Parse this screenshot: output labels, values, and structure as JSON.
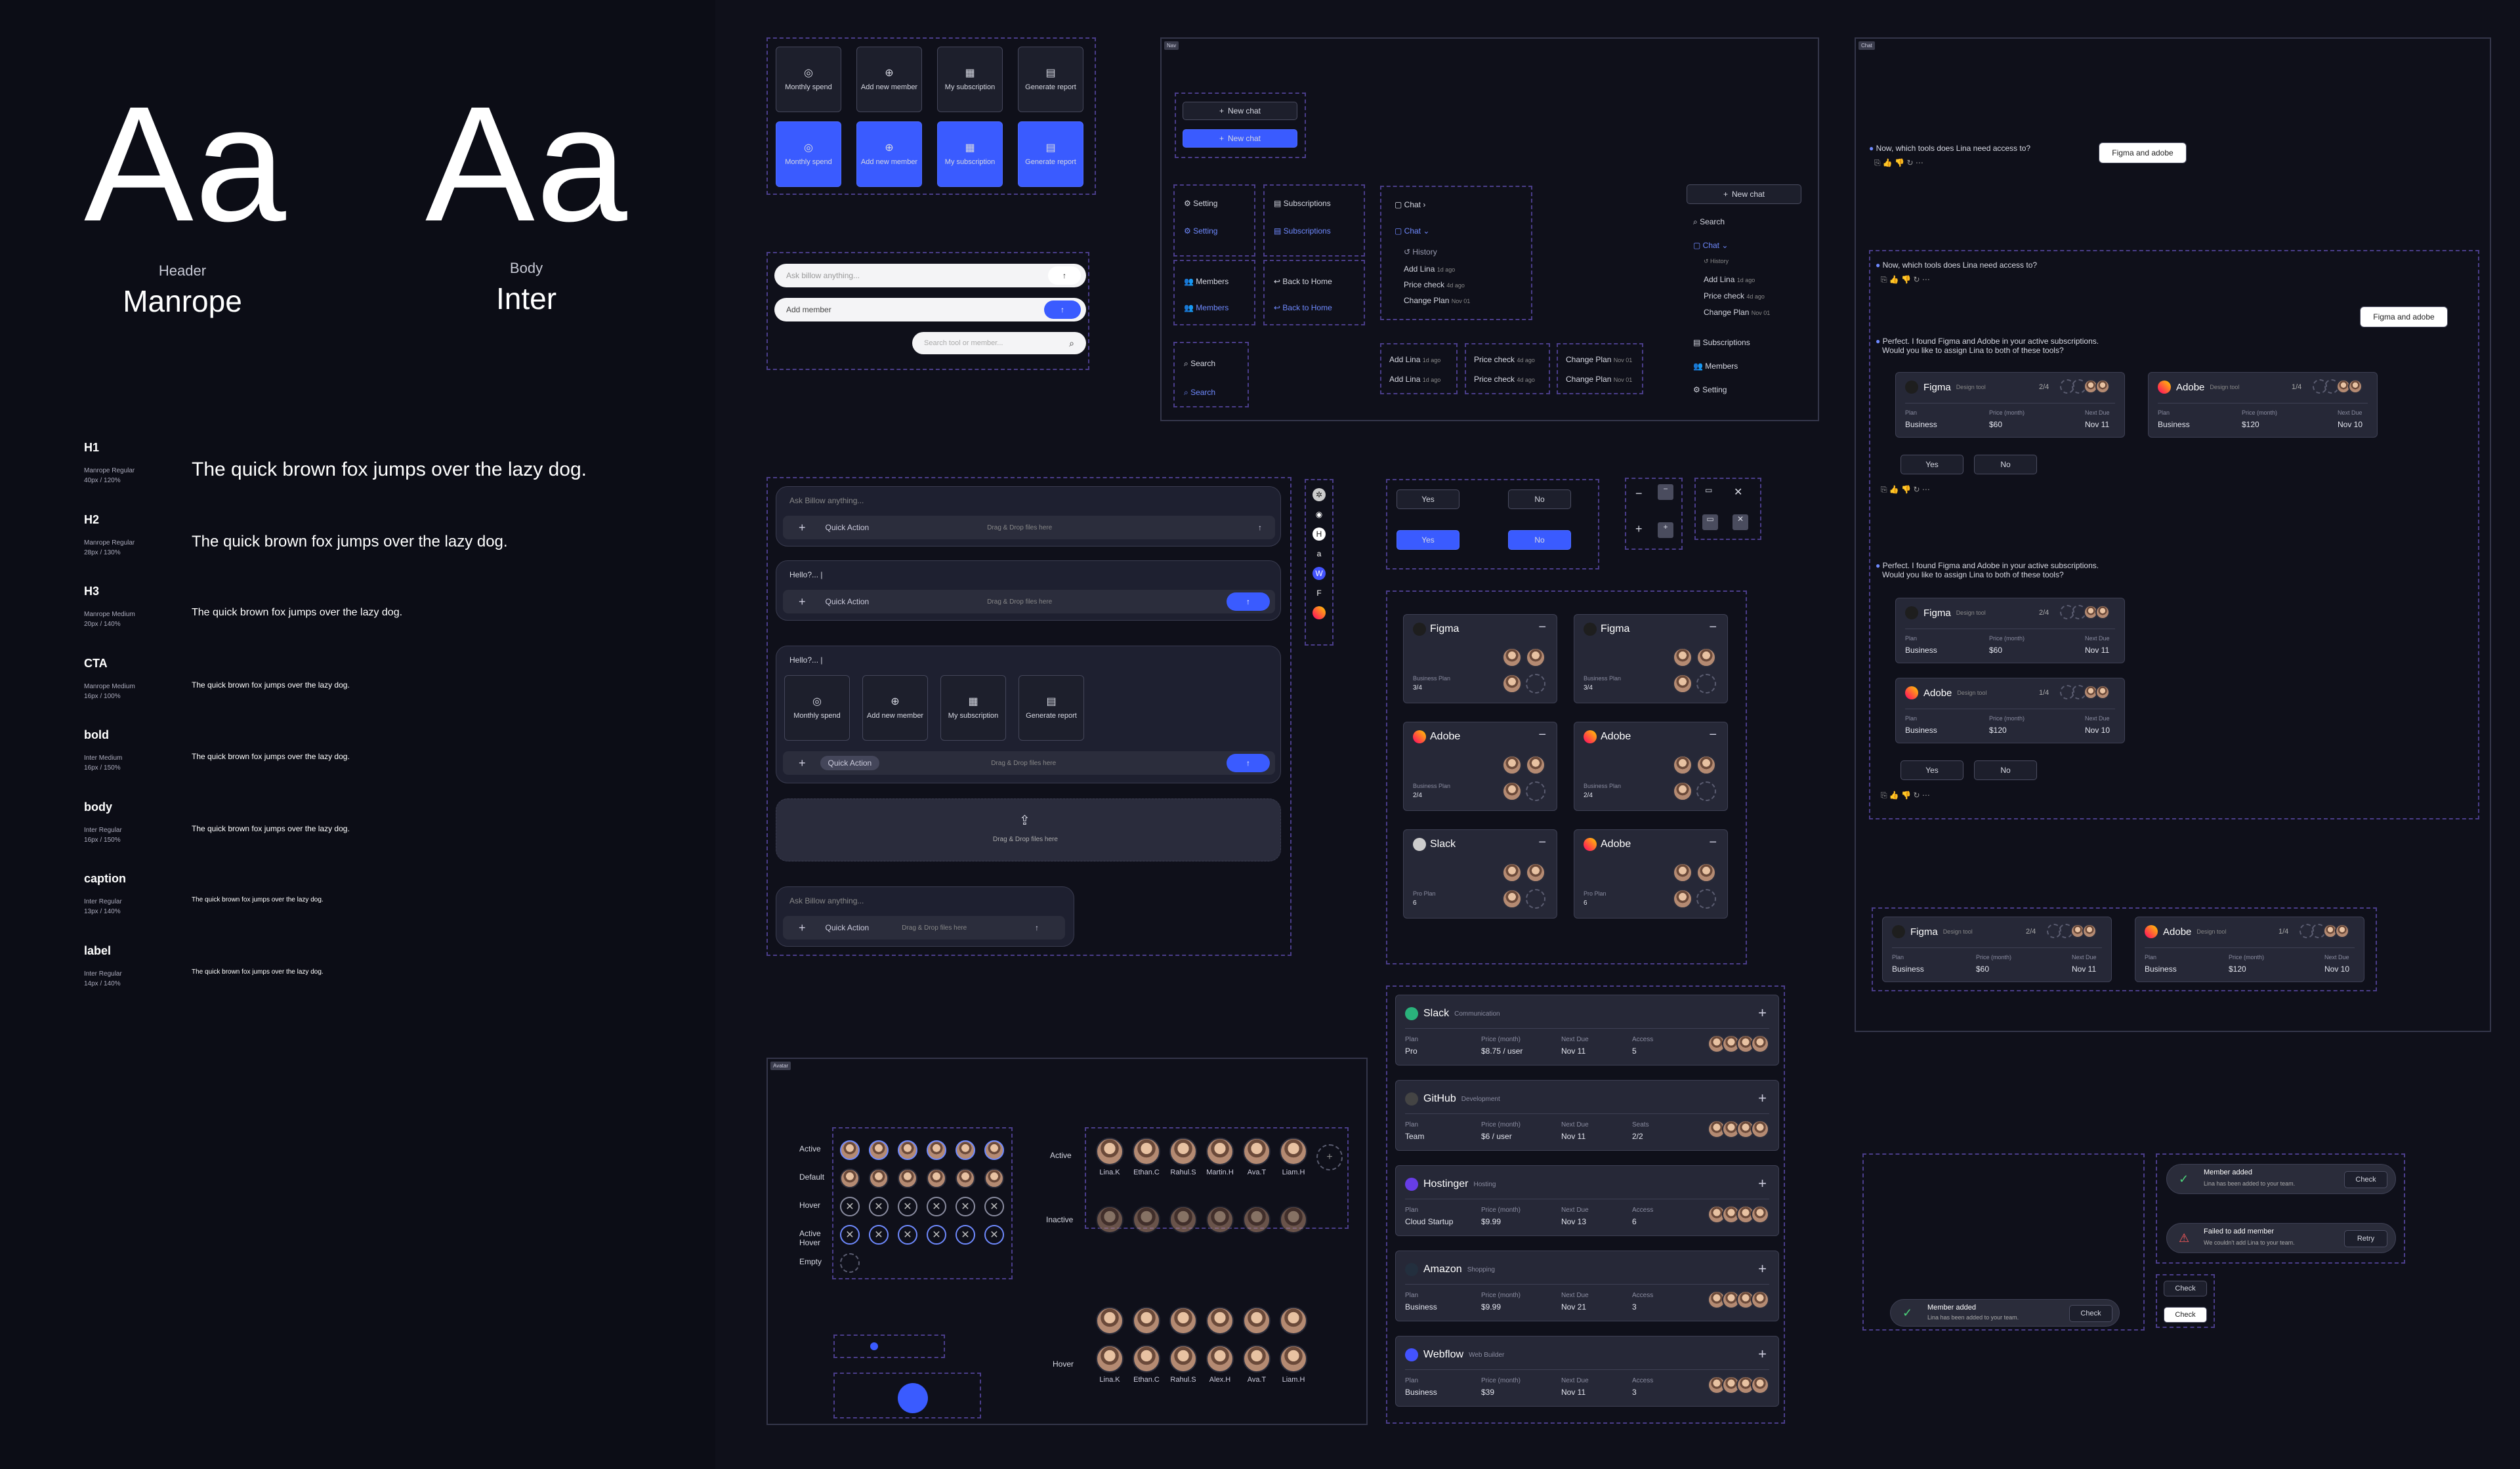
{
  "typography": {
    "header_caption": "Header",
    "header_family": "Manrope",
    "body_caption": "Body",
    "body_family": "Inter",
    "aa": "Aa",
    "styles": [
      {
        "name": "H1",
        "meta1": "Manrope Regular",
        "meta2": "40px / 120%",
        "sample": "The quick brown fox jumps over the lazy dog."
      },
      {
        "name": "H2",
        "meta1": "Manrope Regular",
        "meta2": "28px / 130%",
        "sample": "The quick brown fox jumps over the lazy dog."
      },
      {
        "name": "H3",
        "meta1": "Manrope Medium",
        "meta2": "20px / 140%",
        "sample": "The quick brown fox jumps over the lazy dog."
      },
      {
        "name": "CTA",
        "meta1": "Manrope Medium",
        "meta2": "16px / 100%",
        "sample": "The quick brown fox jumps over the lazy dog."
      },
      {
        "name": "bold",
        "meta1": "Inter Medium",
        "meta2": "16px / 150%",
        "sample": "The quick brown fox jumps over the lazy dog."
      },
      {
        "name": "body",
        "meta1": "Inter Regular",
        "meta2": "16px / 150%",
        "sample": "The quick brown fox jumps over the lazy dog."
      },
      {
        "name": "caption",
        "meta1": "Inter Regular",
        "meta2": "13px / 140%",
        "sample": "The quick brown fox jumps over the lazy dog."
      },
      {
        "name": "label",
        "meta1": "Inter Regular",
        "meta2": "14px / 140%",
        "sample": "The quick brown fox jumps over the lazy dog."
      }
    ]
  },
  "tiles": {
    "monthly": "Monthly spend",
    "add_member": "Add new member",
    "subscription": "My subscription",
    "report": "Generate report"
  },
  "inputs": {
    "ask": "Ask billow anything...",
    "add_member": "Add member",
    "search": "Search tool or member..."
  },
  "nav_tag": "Nav",
  "chat_tag": "Chat",
  "avatar_tag": "Avatar",
  "nav": {
    "new_chat": "New chat",
    "setting": "Setting",
    "subscriptions": "Subscriptions",
    "members": "Members",
    "back_home": "Back to Home",
    "search": "Search",
    "chat": "Chat",
    "history": "History",
    "history_items": [
      {
        "t": "Add Lina",
        "d": "1d ago"
      },
      {
        "t": "Price check",
        "d": "4d ago"
      },
      {
        "t": "Change Plan",
        "d": "Nov 01"
      }
    ]
  },
  "composer": {
    "ask": "Ask Billow anything...",
    "hello": "Hello?... |",
    "quick_action": "Quick Action",
    "drag": "Drag & Drop files here"
  },
  "yesno": {
    "yes": "Yes",
    "no": "No"
  },
  "mini_cards": [
    {
      "name": "Figma",
      "plan": "Business Plan",
      "count": "3/4"
    },
    {
      "name": "Figma",
      "plan": "Business Plan",
      "count": "3/4"
    },
    {
      "name": "Adobe",
      "plan": "Business Plan",
      "count": "2/4"
    },
    {
      "name": "Adobe",
      "plan": "Business Plan",
      "count": "2/4"
    },
    {
      "name": "Slack",
      "plan": "Pro Plan",
      "count": "6"
    },
    {
      "name": "Adobe",
      "plan": "Pro Plan",
      "count": "6"
    }
  ],
  "tools": [
    {
      "name": "Slack",
      "cat": "Communication",
      "plan": "Pro",
      "price": "$8.75 / user",
      "due": "Nov 11",
      "extra_label": "Access",
      "extra": "5",
      "color": "#2ab27b"
    },
    {
      "name": "GitHub",
      "cat": "Development",
      "plan": "Team",
      "price": "$6 / user",
      "due": "Nov 11",
      "extra_label": "Seats",
      "extra": "2/2",
      "color": "#444"
    },
    {
      "name": "Hostinger",
      "cat": "Hosting",
      "plan": "Cloud Startup",
      "price": "$9.99",
      "due": "Nov 13",
      "extra_label": "Access",
      "extra": "6",
      "color": "#673de6"
    },
    {
      "name": "Amazon",
      "cat": "Shopping",
      "plan": "Business",
      "price": "$9.99",
      "due": "Nov 21",
      "extra_label": "Access",
      "extra": "3",
      "color": "#232f3e"
    },
    {
      "name": "Webflow",
      "cat": "Web Builder",
      "plan": "Business",
      "price": "$39",
      "due": "Nov 11",
      "extra_label": "Access",
      "extra": "3",
      "color": "#4353ff"
    }
  ],
  "tool_fields": {
    "plan": "Plan",
    "price": "Price (month)",
    "due": "Next Due"
  },
  "avatar_states": {
    "active": "Active",
    "default": "Default",
    "hover": "Hover",
    "active_hover": "Active Hover",
    "empty": "Empty",
    "inactive": "Inactive",
    "names": [
      "Lina.K",
      "Ethan.C",
      "Rahul.S",
      "Martin.H",
      "Ava.T",
      "Liam.H"
    ],
    "names2": [
      "Lina.K",
      "Ethan.C",
      "Rahul.S",
      "Alex.H",
      "Ava.T",
      "Liam.H"
    ]
  },
  "chat": {
    "q1": "Now, which tools does Lina need access to?",
    "reply": "Figma and adobe",
    "reply2": "Figma and adobe",
    "ans1": "Perfect. I found Figma and Adobe in your active subscriptions.",
    "ans1b": "Would you like to assign Lina to both of these tools?",
    "ans2": "Perfect. I found Figma and Adobe in your active subscriptions.",
    "ans2b": "Would you like to assign Lina to both of these tools?",
    "figma": "Figma",
    "adobe": "Adobe",
    "design_tool": "Design tool",
    "business": "Business",
    "figma_price": "$60",
    "adobe_price": "$120",
    "figma_due": "Nov 11",
    "adobe_due": "Nov 10",
    "figma_count": "2/4",
    "adobe_count": "1/4"
  },
  "toasts": {
    "added": "Member added",
    "added_desc": "Lina has been added to your team.",
    "failed": "Failed to add member",
    "failed_desc": "We couldn't add Lina to your team.",
    "check": "Check",
    "retry": "Retry"
  }
}
